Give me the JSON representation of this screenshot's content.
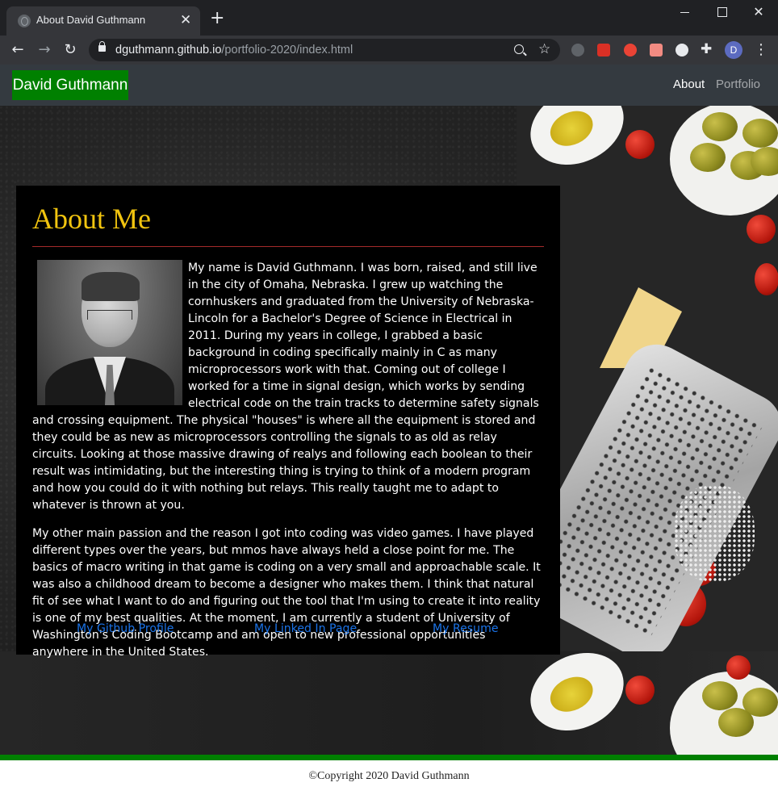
{
  "browser": {
    "tab_title": "About David Guthmann",
    "tab_close": "✕",
    "new_tab": "+",
    "url_host": "dguthmann.github.io",
    "url_path": "/portfolio-2020/index.html",
    "avatar_letter": "D",
    "window_close": "✕"
  },
  "site": {
    "brand": "David Guthmann",
    "nav": [
      {
        "label": "About",
        "active": true
      },
      {
        "label": "Portfolio",
        "active": false
      }
    ],
    "accent_green": "#008000",
    "title_color": "#f1c40f"
  },
  "about": {
    "title": "About Me",
    "paragraph1": "My name is David Guthmann. I was born, raised, and still live in the city of Omaha, Nebraska. I grew up watching the cornhuskers and graduated from the University of Nebraska-Lincoln for a Bachelor's Degree of Science in Electrical in 2011. During my years in college, I grabbed a basic background in coding specifically mainly in C as many microprocessors work with that. Coming out of college I worked for a time in signal design, which works by sending electrical code on the train tracks to determine safety signals and crossing equipment. The physical \"houses\" is where all the equipment is stored and they could be as new as microprocessors controlling the signals to as old as relay circuits. Looking at those massive drawing of realys and following each boolean to their result was intimidating, but the interesting thing is trying to think of a modern program and how you could do it with nothing but relays. This really taught me to adapt to whatever is thrown at you.",
    "paragraph2": "My other main passion and the reason I got into coding was video games. I have played different types over the years, but mmos have always held a close point for me. The basics of macro writing in that game is coding on a very small and approachable scale. It was also a childhood dream to become a designer who makes them. I think that natural fit of see what I want to do and figuring out the tool that I'm using to create it into reality is one of my best qualities. At the moment, I am currently a student of University of Washington's Coding Bootcamp and am open to new professional opportunities anywhere in the United States.",
    "links": {
      "github": "My Github Profile",
      "linkedin": "My Linked In Page",
      "resume": "My Resume"
    }
  },
  "footer": {
    "copyright": "©Copyright 2020 David Guthmann"
  }
}
